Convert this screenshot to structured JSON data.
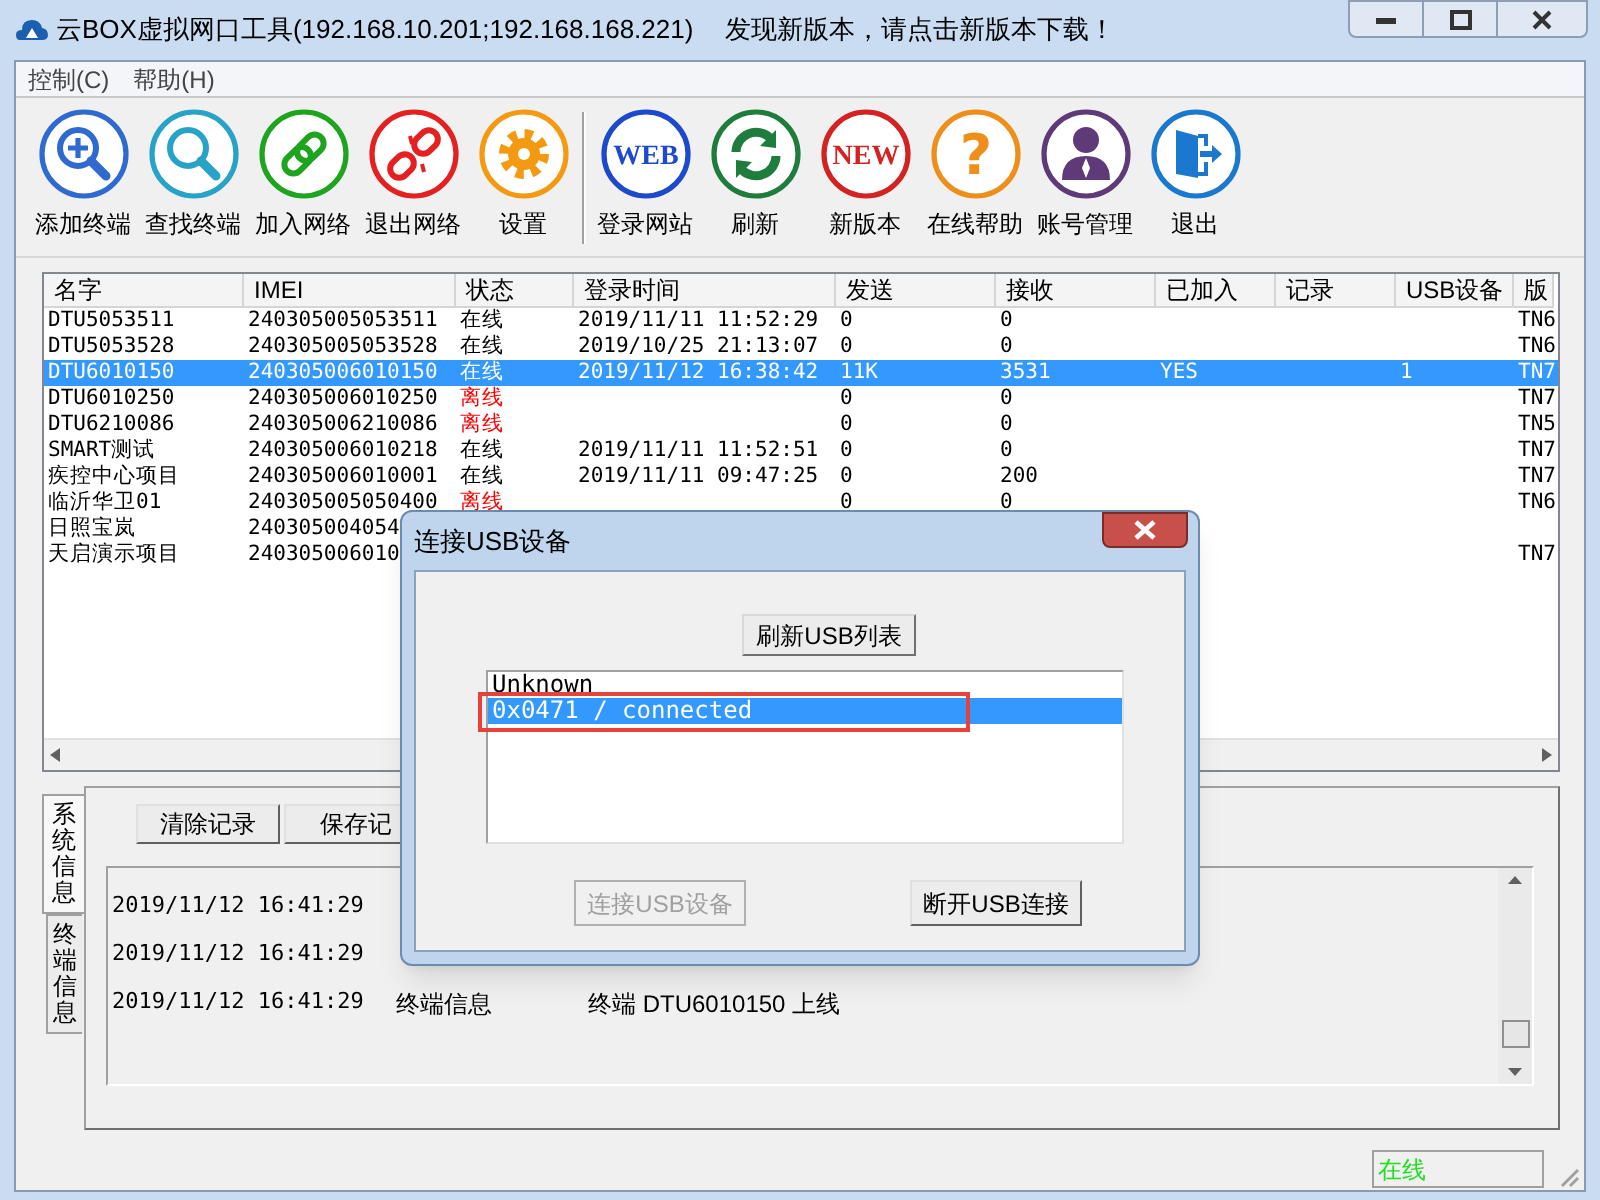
{
  "window": {
    "title": "云BOX虚拟网口工具(192.168.10.201;192.168.168.221)",
    "notice": "发现新版本，请点击新版本下载！"
  },
  "menu": [
    "控制(C)",
    "帮助(H)"
  ],
  "toolbar": {
    "groups": [
      [
        {
          "kind": "add-search",
          "label": "添加终端"
        },
        {
          "kind": "search",
          "label": "查找终端"
        },
        {
          "kind": "link",
          "label": "加入网络"
        },
        {
          "kind": "unlink",
          "label": "退出网络"
        },
        {
          "kind": "gear",
          "label": "设置"
        }
      ],
      [
        {
          "kind": "web",
          "glyph": "WEB",
          "label": "登录网站"
        },
        {
          "kind": "refresh",
          "label": "刷新"
        },
        {
          "kind": "new",
          "glyph": "NEW",
          "label": "新版本"
        },
        {
          "kind": "help",
          "glyph": "?",
          "label": "在线帮助"
        },
        {
          "kind": "user",
          "label": "账号管理"
        },
        {
          "kind": "exit",
          "label": "退出"
        }
      ]
    ]
  },
  "table": {
    "columns": [
      "名字",
      "IMEI",
      "状态",
      "登录时间",
      "发送",
      "接收",
      "已加入",
      "记录",
      "USB设备",
      "版"
    ],
    "rows": [
      {
        "selected": false,
        "online": true,
        "cells": [
          "DTU5053511",
          "240305005053511",
          "在线",
          "2019/11/11 11:52:29",
          "0",
          "0",
          null,
          null,
          null,
          "TN6"
        ]
      },
      {
        "selected": false,
        "online": true,
        "cells": [
          "DTU5053528",
          "240305005053528",
          "在线",
          "2019/10/25 21:13:07",
          "0",
          "0",
          null,
          null,
          null,
          "TN6"
        ]
      },
      {
        "selected": true,
        "online": true,
        "cells": [
          "DTU6010150",
          "240305006010150",
          "在线",
          "2019/11/12 16:38:42",
          "11K",
          "3531",
          "YES",
          null,
          "1",
          "TN7"
        ]
      },
      {
        "selected": false,
        "online": false,
        "cells": [
          "DTU6010250",
          "240305006010250",
          "离线",
          null,
          "0",
          "0",
          null,
          null,
          null,
          "TN7"
        ]
      },
      {
        "selected": false,
        "online": false,
        "cells": [
          "DTU6210086",
          "240305006210086",
          "离线",
          null,
          "0",
          "0",
          null,
          null,
          null,
          "TN5"
        ]
      },
      {
        "selected": false,
        "online": true,
        "cells": [
          "SMART测试",
          "240305006010218",
          "在线",
          "2019/11/11 11:52:51",
          "0",
          "0",
          null,
          null,
          null,
          "TN7"
        ]
      },
      {
        "selected": false,
        "online": true,
        "cells": [
          "疾控中心项目",
          "240305006010001",
          "在线",
          "2019/11/11 09:47:25",
          "0",
          "200",
          null,
          null,
          null,
          "TN7"
        ]
      },
      {
        "selected": false,
        "online": false,
        "cells": [
          "临沂华卫01",
          "240305005050400",
          "离线",
          null,
          "0",
          "0",
          null,
          null,
          null,
          "TN6"
        ]
      },
      {
        "selected": false,
        "cells": [
          "日照宝岚",
          "240305004054",
          null,
          null,
          null,
          null,
          null,
          null,
          null,
          null
        ]
      },
      {
        "selected": false,
        "cells": [
          "天启演示项目",
          "240305006010",
          null,
          null,
          null,
          null,
          null,
          null,
          null,
          "TN7"
        ]
      }
    ]
  },
  "log": {
    "tabs": [
      {
        "label": "系统信息",
        "selected": true
      },
      {
        "label": "终端信息",
        "selected": false
      }
    ],
    "buttons": [
      "清除记录",
      "保存记"
    ],
    "entries": [
      {
        "time": "2019/11/12 16:41:29"
      },
      {
        "time": "2019/11/12 16:41:29"
      },
      {
        "time": "2019/11/12 16:41:29",
        "type": "终端信息",
        "message": "终端 DTU6010150 上线"
      }
    ]
  },
  "status_bar": {
    "state": "在线"
  },
  "dialog": {
    "title": "连接USB设备",
    "refresh_button": "刷新USB列表",
    "devices": [
      {
        "label": "Unknown",
        "selected": false,
        "marked": false
      },
      {
        "label": "0x0471 / connected",
        "selected": true,
        "marked": true
      }
    ],
    "buttons": [
      {
        "label": "连接USB设备",
        "disabled": true
      },
      {
        "label": "断开USB连接",
        "disabled": false
      }
    ]
  }
}
